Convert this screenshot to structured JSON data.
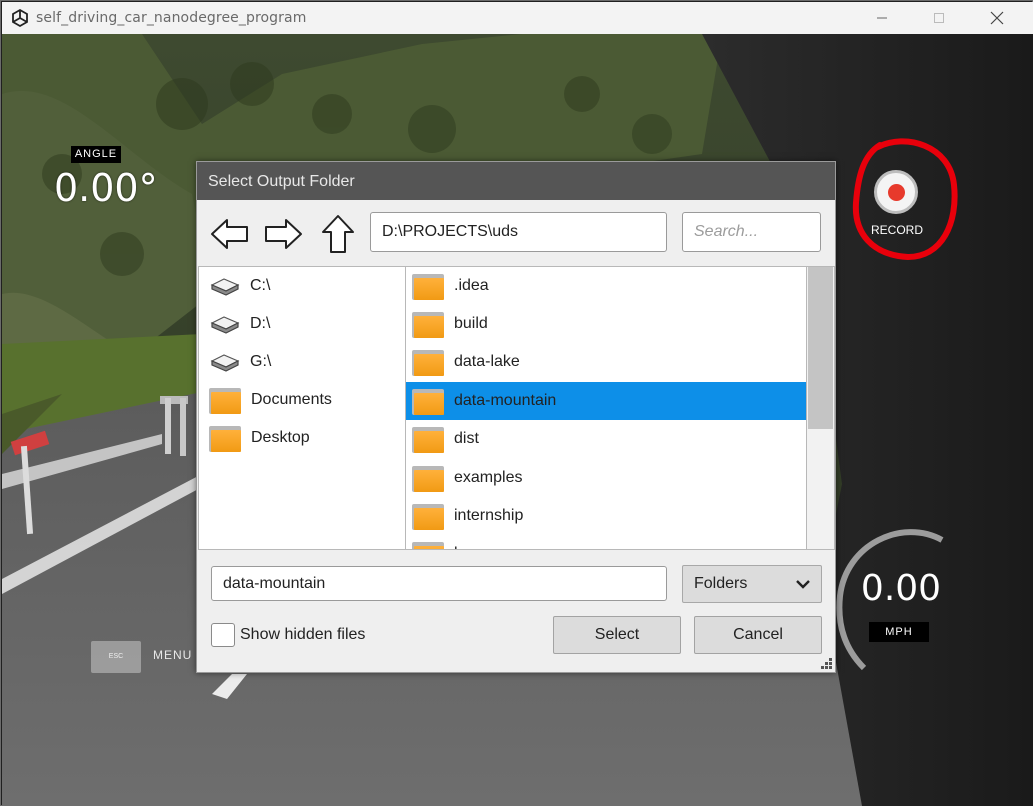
{
  "window": {
    "title": "self_driving_car_nanodegree_program",
    "controls": {
      "minimize": "minimize-icon",
      "maximize": "maximize-icon",
      "close": "close-icon"
    }
  },
  "hud": {
    "angle_label": "ANGLE",
    "angle_value": "0.00°",
    "record_label": "RECORD",
    "speed_value": "0.00",
    "speed_unit": "MPH",
    "esc_key": "ESC",
    "menu_label": "MENU",
    "record_color": "#e73a2c",
    "highlight_color": "#e8000b"
  },
  "dialog": {
    "title": "Select Output Folder",
    "nav": {
      "back": "left-arrow-icon",
      "forward": "right-arrow-icon",
      "up": "up-arrow-icon"
    },
    "path": "D:\\PROJECTS\\uds",
    "search_placeholder": "Search...",
    "drives": [
      {
        "label": "C:\\",
        "icon": "drive-icon"
      },
      {
        "label": "D:\\",
        "icon": "drive-icon"
      },
      {
        "label": "G:\\",
        "icon": "drive-icon"
      },
      {
        "label": "Documents",
        "icon": "folder-icon"
      },
      {
        "label": "Desktop",
        "icon": "folder-icon"
      }
    ],
    "folders": [
      {
        "label": ".idea"
      },
      {
        "label": "build"
      },
      {
        "label": "data-lake"
      },
      {
        "label": "data-mountain",
        "selected": true
      },
      {
        "label": "dist"
      },
      {
        "label": "examples"
      },
      {
        "label": "internship"
      },
      {
        "label": "l"
      }
    ],
    "selection_color": "#0d8fe8",
    "filename": "data-mountain",
    "filter": "Folders",
    "show_hidden_label": "Show hidden files",
    "show_hidden_checked": false,
    "select_label": "Select",
    "cancel_label": "Cancel"
  }
}
